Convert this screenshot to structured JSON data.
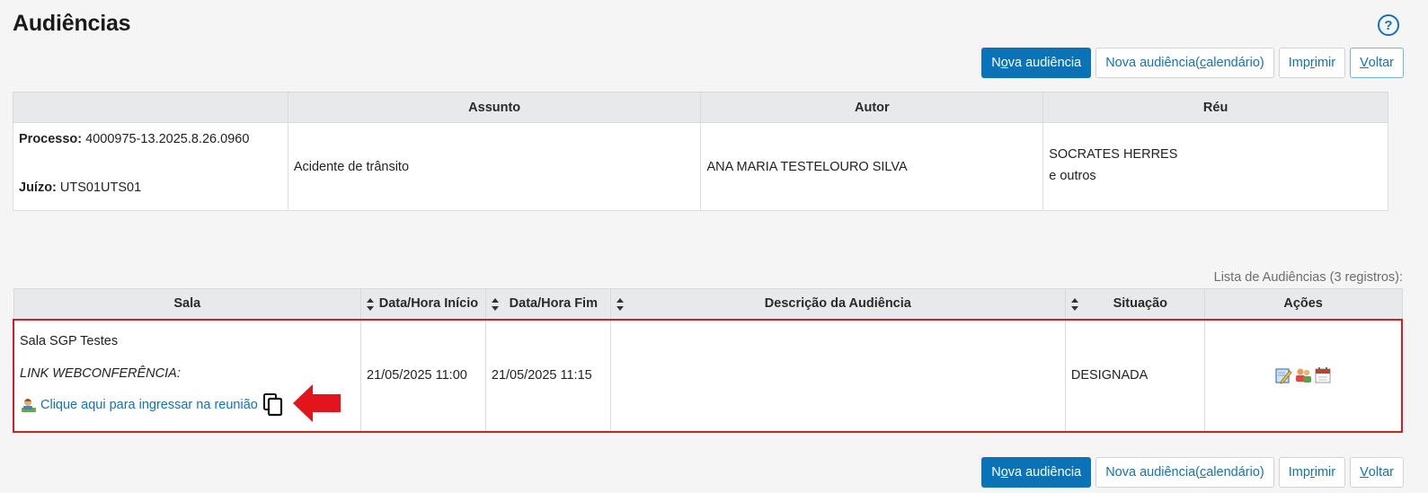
{
  "page": {
    "title": "Audiências",
    "help_label": "?"
  },
  "toolbar": {
    "nova_audiencia": {
      "pre": "N",
      "u": "o",
      "post": "va audiência"
    },
    "nova_calendario": {
      "pre": "Nova audiência(",
      "u": "c",
      "post": "alendário)"
    },
    "imprimir": {
      "pre": "Imp",
      "u": "r",
      "post": "imir"
    },
    "voltar": {
      "pre": "",
      "u": "V",
      "post": "oltar"
    }
  },
  "processo": {
    "headers": [
      "",
      "Assunto",
      "Autor",
      "Réu"
    ],
    "processo_label": "Processo:",
    "processo_value": "4000975-13.2025.8.26.0960",
    "juizo_label": "Juízo:",
    "juizo_value": "UTS01UTS01",
    "assunto": "Acidente de trânsito",
    "autor": "ANA MARIA TESTELOURO SILVA",
    "reu": "SOCRATES HERRES",
    "reu_extra": "e outros"
  },
  "audiencias": {
    "caption": "Lista de Audiências (3 registros):",
    "headers": {
      "sala": "Sala",
      "inicio": "Data/Hora Início",
      "fim": "Data/Hora Fim",
      "descricao": "Descrição da Audiência",
      "situacao": "Situação",
      "acoes": "Ações"
    },
    "rows": [
      {
        "sala": "Sala SGP Testes",
        "link_label": "LINK WEBCONFERÊNCIA:",
        "join_text": "Clique aqui para ingressar na reunião",
        "inicio": "21/05/2025 11:00",
        "fim": "21/05/2025 11:15",
        "descricao": "",
        "situacao": "DESIGNADA"
      }
    ]
  },
  "colors": {
    "primary": "#0a73b7",
    "link": "#1272b8",
    "highlight": "#d61d26",
    "arrow": "#e3141b"
  },
  "icons": [
    "help-icon",
    "sort-icon",
    "person-icon",
    "copy-icon",
    "arrow-icon",
    "edit-icon",
    "participants-icon",
    "calendar-icon"
  ]
}
